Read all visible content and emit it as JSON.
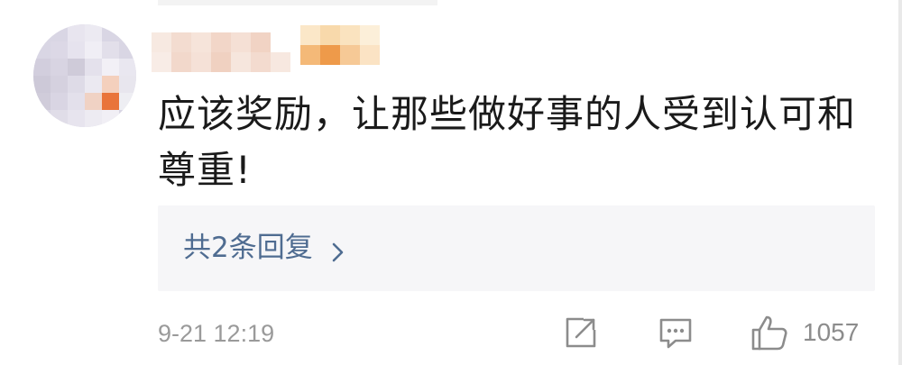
{
  "comment": {
    "text": "应该奖励，让那些做好事的人受到认可和尊重!",
    "timestamp": "9-21 12:19",
    "replies_label": "共2条回复",
    "like_count": "1057"
  },
  "icons": {
    "share": "share-icon",
    "comment": "comment-icon",
    "like": "thumbs-up-icon",
    "chevron": "chevron-right-icon"
  },
  "colors": {
    "link": "#4f6c91",
    "meta": "#9a9a9a",
    "text": "#1a1a1a",
    "replies_bg": "#f6f6f8"
  }
}
